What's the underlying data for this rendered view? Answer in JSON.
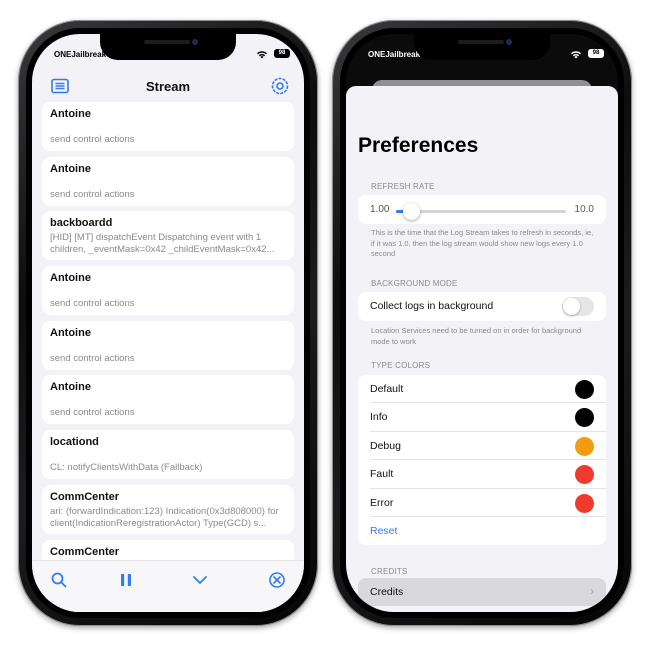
{
  "left_phone": {
    "status": {
      "carrier": "ONEJailbreak",
      "battery": "98"
    },
    "nav": {
      "title": "Stream",
      "list_icon": "list-icon",
      "settings_icon": "gear-icon"
    },
    "entries": [
      {
        "title": "Antoine",
        "message": "send control actions"
      },
      {
        "title": "Antoine",
        "message": "send control actions"
      },
      {
        "title": "backboardd",
        "message": "[HID] [MT] dispatchEvent Dispatching event with 1 children, _eventMask=0x42 _childEventMask=0x42..."
      },
      {
        "title": "Antoine",
        "message": "send control actions"
      },
      {
        "title": "Antoine",
        "message": "send control actions"
      },
      {
        "title": "Antoine",
        "message": "send control actions"
      },
      {
        "title": "locationd",
        "message": "CL: notifyClientsWithData (Fallback)"
      },
      {
        "title": "CommCenter",
        "message": "ari: (forwardIndication:123) Indication(0x3d808000) for client(IndicationReregistrationActor) Type(GCD) s..."
      },
      {
        "title": "CommCenter",
        "message": ""
      }
    ],
    "toolbar": {
      "icons": [
        "search-icon",
        "pause-icon",
        "chevron-down-icon",
        "clear-icon"
      ]
    }
  },
  "right_phone": {
    "status": {
      "carrier": "ONEJailbreak",
      "battery": "98"
    },
    "title": "Preferences",
    "refresh_rate": {
      "header": "REFRESH RATE",
      "min_label": "1.00",
      "max_label": "10.0",
      "value_fraction": 0.09,
      "footer": "This is the time that the Log Stream takes to refresh in seconds, ie, if it was 1.0, then the log stream would show new logs every 1.0 second"
    },
    "background_mode": {
      "header": "BACKGROUND MODE",
      "label": "Collect logs in background",
      "enabled": false,
      "footer": "Location Services need to be turned on in order for background mode to work"
    },
    "type_colors": {
      "header": "TYPE COLORS",
      "items": [
        {
          "label": "Default",
          "color": "#000000"
        },
        {
          "label": "Info",
          "color": "#000000"
        },
        {
          "label": "Debug",
          "color": "#f39c12"
        },
        {
          "label": "Fault",
          "color": "#f03a2e"
        },
        {
          "label": "Error",
          "color": "#f03a2e"
        }
      ],
      "reset_label": "Reset"
    },
    "credits": {
      "header": "CREDITS",
      "label": "Credits"
    },
    "accent_color": "#2f7cf6"
  }
}
